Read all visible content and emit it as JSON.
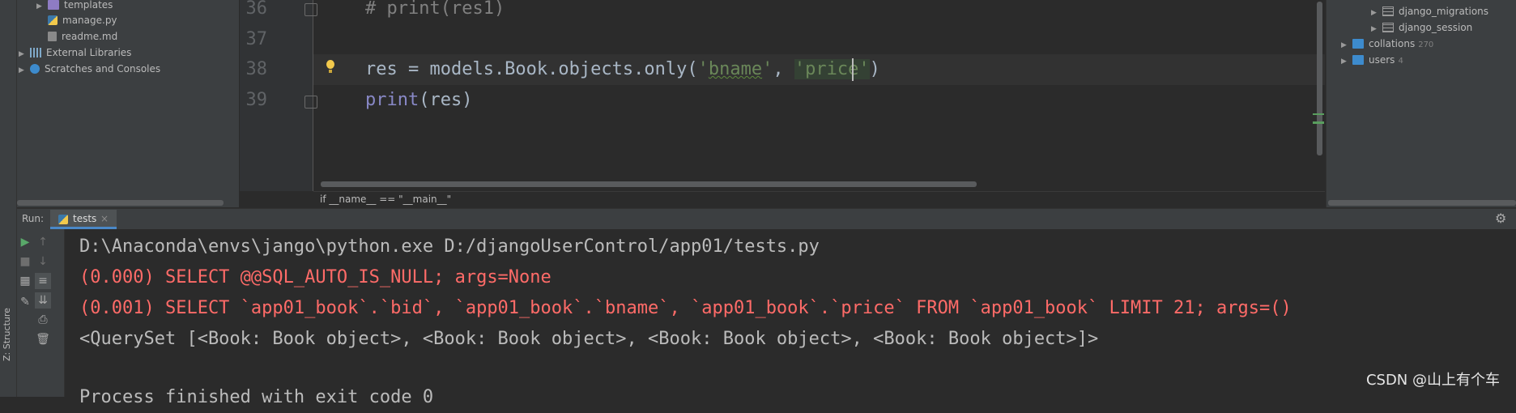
{
  "project_tree": [
    {
      "label": "templates",
      "icon": "folder-icon",
      "expandable": true
    },
    {
      "label": "manage.py",
      "icon": "python-file-icon",
      "expandable": false
    },
    {
      "label": "readme.md",
      "icon": "markdown-file-icon",
      "expandable": false
    },
    {
      "label": "External Libraries",
      "icon": "library-icon",
      "expandable": true
    },
    {
      "label": "Scratches and Consoles",
      "icon": "scratch-icon",
      "expandable": true
    }
  ],
  "editor": {
    "line_numbers": [
      "36",
      "37",
      "38",
      "39"
    ],
    "line36": "# print(res1)",
    "line38": {
      "pre": "res = models.Book.objects.only(",
      "q1": "'",
      "s1": "bname",
      "q2": "'",
      "sep": ", ",
      "s2": "'price'",
      "post": ")"
    },
    "line39": {
      "fn": "print",
      "args": "(res)"
    },
    "breadcrumb": "if __name__ == \"__main__\""
  },
  "database_tree": [
    {
      "label": "django_migrations",
      "icon": "table-icon",
      "count": ""
    },
    {
      "label": "django_session",
      "icon": "table-icon",
      "count": ""
    },
    {
      "label": "collations",
      "icon": "folder-icon",
      "count": "270"
    },
    {
      "label": "users",
      "icon": "folder-icon",
      "count": "4"
    }
  ],
  "run_window": {
    "label": "Run:",
    "tab": "tests",
    "side_tab": "Z: Structure",
    "output": [
      {
        "kind": "cmd",
        "text": "D:\\Anaconda\\envs\\jango\\python.exe D:/djangoUserControl/app01/tests.py"
      },
      {
        "kind": "err",
        "text": "(0.000) SELECT @@SQL_AUTO_IS_NULL; args=None"
      },
      {
        "kind": "err",
        "text": "(0.001) SELECT `app01_book`.`bid`, `app01_book`.`bname`, `app01_book`.`price` FROM `app01_book` LIMIT 21; args=()"
      },
      {
        "kind": "norm",
        "text": "<QuerySet [<Book: Book object>, <Book: Book object>, <Book: Book object>, <Book: Book object>]>"
      },
      {
        "kind": "norm",
        "text": ""
      },
      {
        "kind": "norm",
        "text": "Process finished with exit code 0"
      }
    ]
  },
  "watermark": "CSDN @山上有个车",
  "colors": {
    "string": "#6a8759",
    "comment": "#808080",
    "builtin": "#8888c6",
    "error": "#ff6b68",
    "accent": "#4a88c7"
  }
}
